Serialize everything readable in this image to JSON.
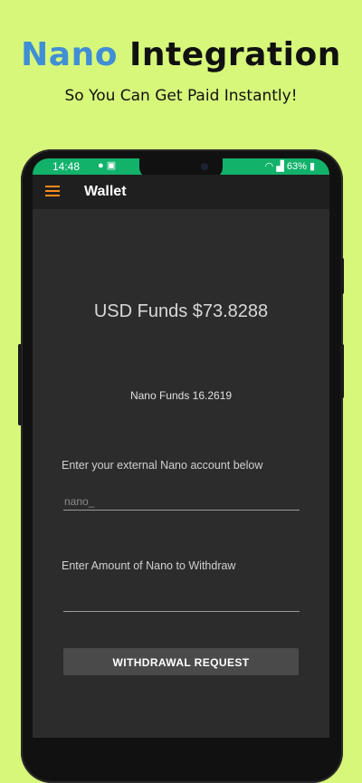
{
  "promo": {
    "headline_accent": "Nano",
    "headline_rest": " Integration",
    "subtitle": "So You Can Get Paid Instantly!",
    "accent_color": "#3f8ed6",
    "background_color": "#d7f77a"
  },
  "status_bar": {
    "time": "14:48",
    "battery": "63%",
    "icons": [
      "notification-icon",
      "image-icon",
      "wifi-icon",
      "signal-icon",
      "battery-icon"
    ],
    "color": "#12b26b"
  },
  "app_bar": {
    "title": "Wallet",
    "menu_icon": "hamburger-menu-icon",
    "menu_color": "#ff8a1a"
  },
  "wallet": {
    "usd_funds": "USD Funds $73.8288",
    "nano_funds": "Nano Funds 16.2619",
    "account_label": "Enter your external Nano account below",
    "account_placeholder": "nano_",
    "account_value": "",
    "amount_label": "Enter Amount of Nano to Withdraw",
    "amount_placeholder": "",
    "amount_value": "",
    "withdraw_button": "WITHDRAWAL REQUEST"
  }
}
